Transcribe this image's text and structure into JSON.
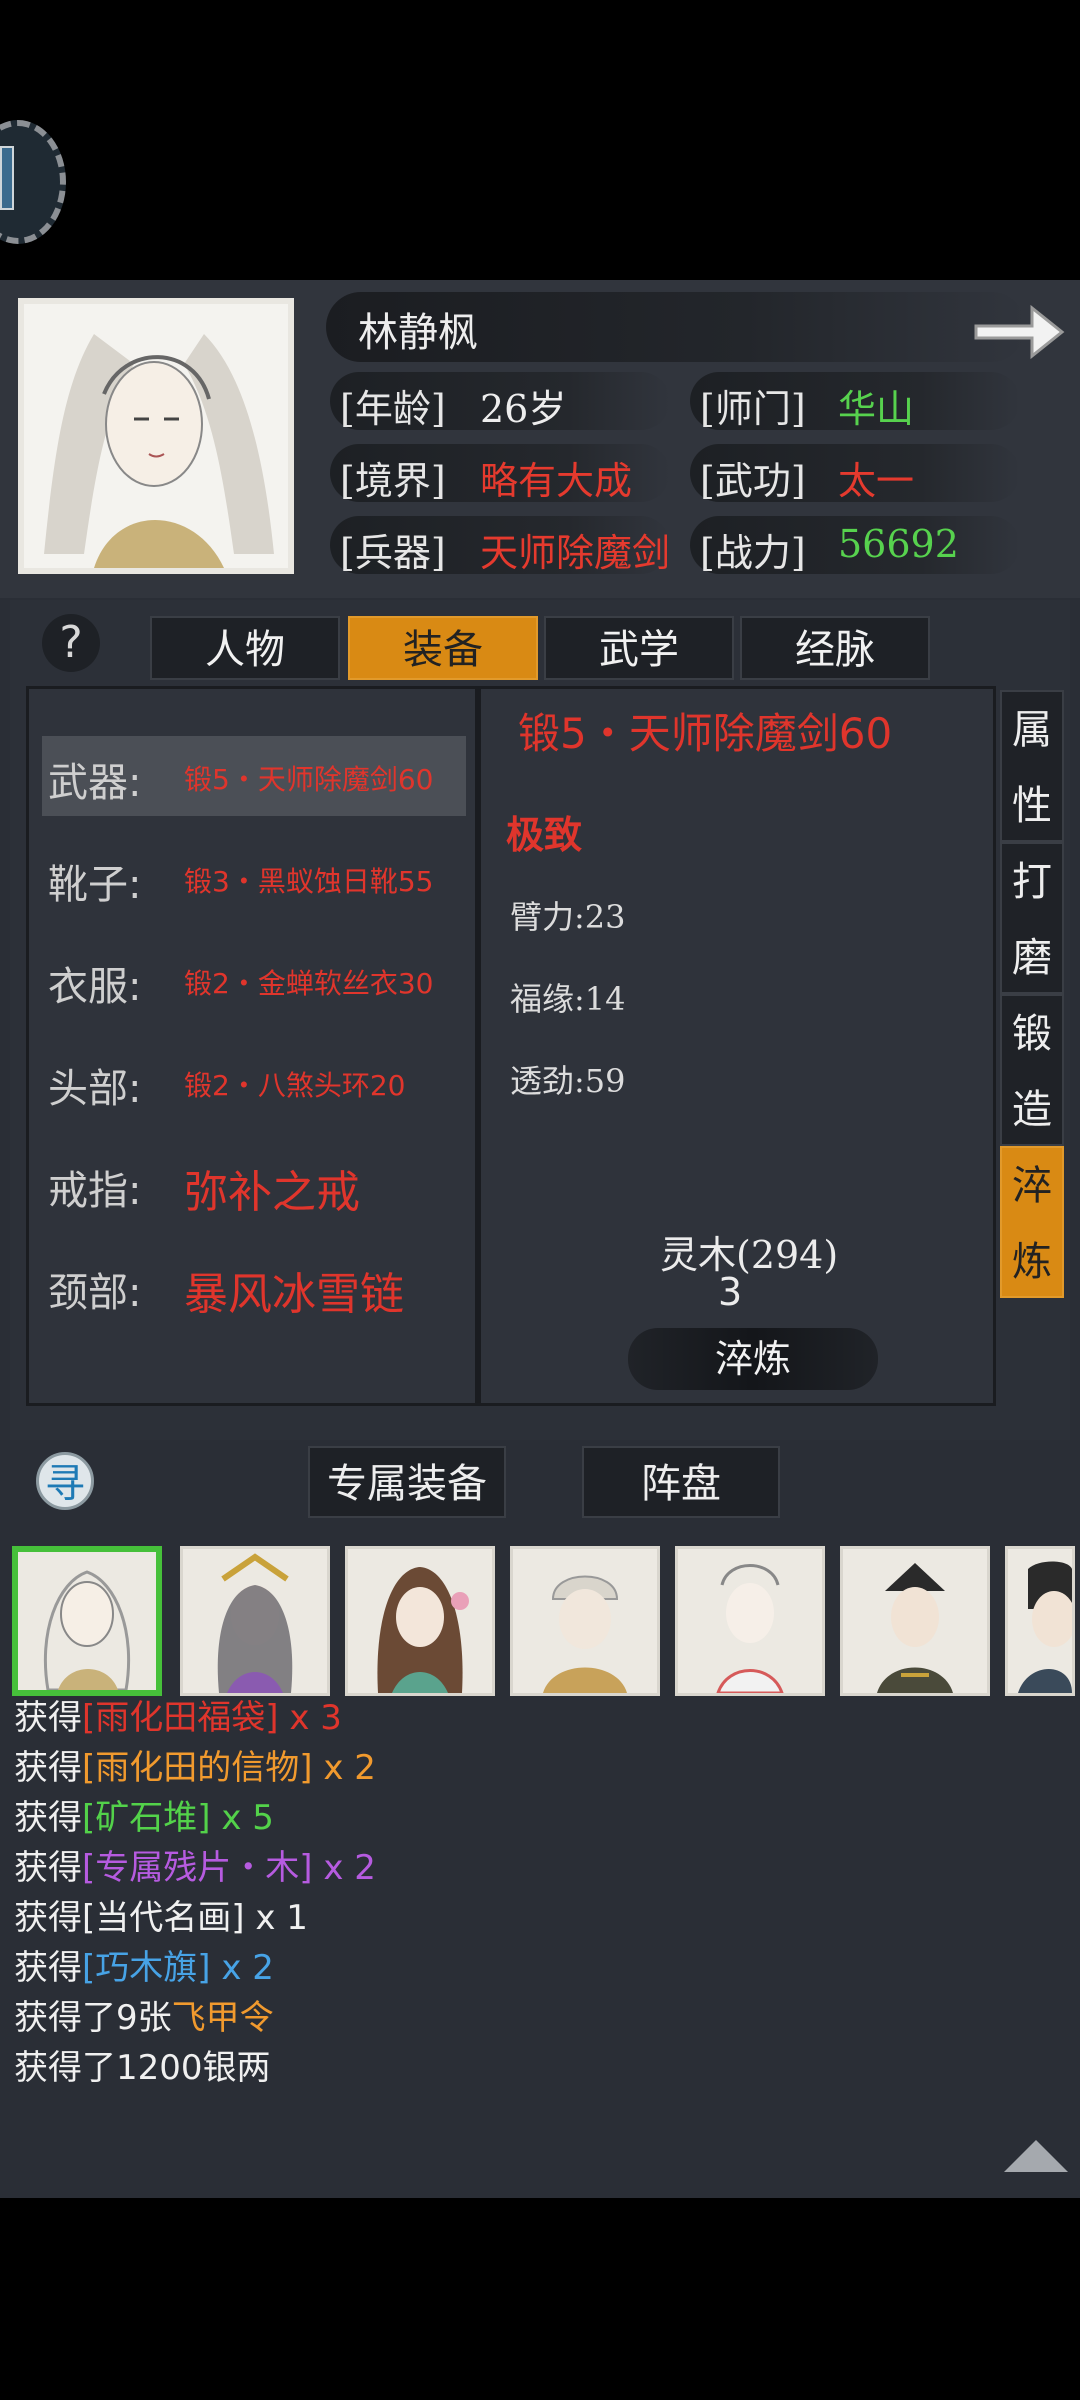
{
  "hero": {
    "name": "林静枫",
    "age_label": "[年龄]",
    "age": "26岁",
    "sect_label": "[师门]",
    "sect": "华山",
    "realm_label": "[境界]",
    "realm": "略有大成",
    "martial_label": "[武功]",
    "martial": "太一",
    "weapon_label": "[兵器]",
    "weapon": "天师除魔剑",
    "power_label": "[战力]",
    "power": "56692"
  },
  "tabs": [
    "人物",
    "装备",
    "武学",
    "经脉"
  ],
  "active_tab": "装备",
  "help_icon": "?",
  "equipment": [
    {
      "slot": "武器:",
      "item": "锻5・天师除魔剑60",
      "size": "small"
    },
    {
      "slot": "靴子:",
      "item": "锻3・黑蚁蚀日靴55",
      "size": "small"
    },
    {
      "slot": "衣服:",
      "item": "锻2・金蝉软丝衣30",
      "size": "small"
    },
    {
      "slot": "头部:",
      "item": "锻2・八煞头环20",
      "size": "small"
    },
    {
      "slot": "戒指:",
      "item": "弥补之戒",
      "size": "big"
    },
    {
      "slot": "颈部:",
      "item": "暴风冰雪链",
      "size": "big"
    }
  ],
  "detail": {
    "title": "锻5・天师除魔剑60",
    "quality": "极致",
    "stats": [
      "臂力:23",
      "福缘:14",
      "透劲:59"
    ],
    "material": "灵木(294)",
    "material_cost": "3",
    "refine_button": "淬炼"
  },
  "side_tabs": [
    {
      "chars": [
        "属",
        "性"
      ]
    },
    {
      "chars": [
        "打",
        "磨"
      ]
    },
    {
      "chars": [
        "锻",
        "造"
      ]
    },
    {
      "chars": [
        "淬",
        "炼"
      ]
    }
  ],
  "bottom": {
    "search_icon_glyph": "寻",
    "exclusive_equipment": "专属装备",
    "formation": "阵盘"
  },
  "log": [
    {
      "prefix": "获得",
      "item": "[雨化田福袋]",
      "count": " x 3",
      "color": "c-red"
    },
    {
      "prefix": "获得",
      "item": "[雨化田的信物]",
      "count": " x 2",
      "color": "c-orange"
    },
    {
      "prefix": "获得",
      "item": "[矿石堆]",
      "count": " x 5",
      "color": "c-green"
    },
    {
      "prefix": "获得",
      "item": "[专属残片・木]",
      "count": " x 2",
      "color": "c-purple"
    },
    {
      "prefix": "获得",
      "item": "[当代名画]",
      "count": " x 1",
      "color": "c-white"
    },
    {
      "prefix": "获得",
      "item": "[巧木旗]",
      "count": " x 2",
      "color": "c-blue"
    },
    {
      "prefix": "获得了9张",
      "item": "飞甲令",
      "count": "",
      "color": "c-orange"
    },
    {
      "prefix": "获得了1200银两",
      "item": "",
      "count": "",
      "color": "c-white"
    }
  ]
}
